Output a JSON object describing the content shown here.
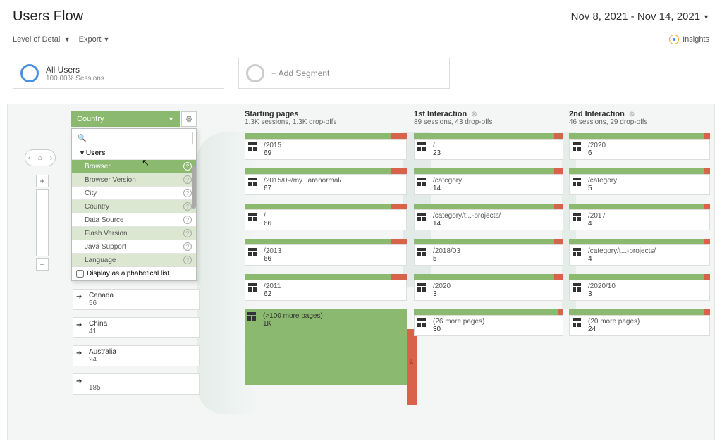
{
  "header": {
    "title": "Users Flow",
    "date_range": "Nov 8, 2021 - Nov 14, 2021"
  },
  "toolbar": {
    "level": "Level of Detail",
    "export": "Export",
    "insights": "Insights"
  },
  "segments": {
    "all_users": "All Users",
    "all_users_sub": "100.00% Sessions",
    "add_segment": "+ Add Segment"
  },
  "dimension": {
    "selected": "Country",
    "group": "Users",
    "options": [
      "Browser",
      "Browser Version",
      "City",
      "Country",
      "Data Source",
      "Flash Version",
      "Java Support",
      "Language"
    ],
    "alpha_label": "Display as alphabetical list"
  },
  "countries": [
    {
      "name": "Canada",
      "num": "56"
    },
    {
      "name": "China",
      "num": "41"
    },
    {
      "name": "Australia",
      "num": "24"
    },
    {
      "name": "",
      "num": "185"
    }
  ],
  "columns": [
    {
      "title": "Starting pages",
      "sub": "1.3K sessions, 1.3K drop-offs",
      "nodes": [
        {
          "label": "/2015",
          "count": "69",
          "g": 90,
          "r": 10
        },
        {
          "label": "/2015/09/my...aranormal/",
          "count": "67",
          "g": 90,
          "r": 10
        },
        {
          "label": "/",
          "count": "66",
          "g": 90,
          "r": 10
        },
        {
          "label": "/2013",
          "count": "66",
          "g": 90,
          "r": 10
        },
        {
          "label": "/2011",
          "count": "62",
          "g": 90,
          "r": 10
        }
      ],
      "more": {
        "label": "(>100 more pages)",
        "count": "1K"
      }
    },
    {
      "title": "1st Interaction",
      "sub": "89 sessions, 43 drop-offs",
      "nodes": [
        {
          "label": "/",
          "count": "23",
          "g": 94,
          "r": 6
        },
        {
          "label": "/category",
          "count": "14",
          "g": 94,
          "r": 6
        },
        {
          "label": "/category/t...-projects/",
          "count": "14",
          "g": 94,
          "r": 6
        },
        {
          "label": "/2018/03",
          "count": "5",
          "g": 94,
          "r": 6
        },
        {
          "label": "/2020",
          "count": "3",
          "g": 94,
          "r": 6
        }
      ],
      "more_row": {
        "label": "(26 more pages)",
        "count": "30"
      }
    },
    {
      "title": "2nd Interaction",
      "sub": "46 sessions, 29 drop-offs",
      "nodes": [
        {
          "label": "/2020",
          "count": "6",
          "g": 96,
          "r": 4
        },
        {
          "label": "/category",
          "count": "5",
          "g": 96,
          "r": 4
        },
        {
          "label": "/2017",
          "count": "4",
          "g": 96,
          "r": 4
        },
        {
          "label": "/category/t...-projects/",
          "count": "4",
          "g": 96,
          "r": 4
        },
        {
          "label": "/2020/10",
          "count": "3",
          "g": 96,
          "r": 4
        }
      ],
      "more_row": {
        "label": "(20 more pages)",
        "count": "24"
      }
    }
  ]
}
